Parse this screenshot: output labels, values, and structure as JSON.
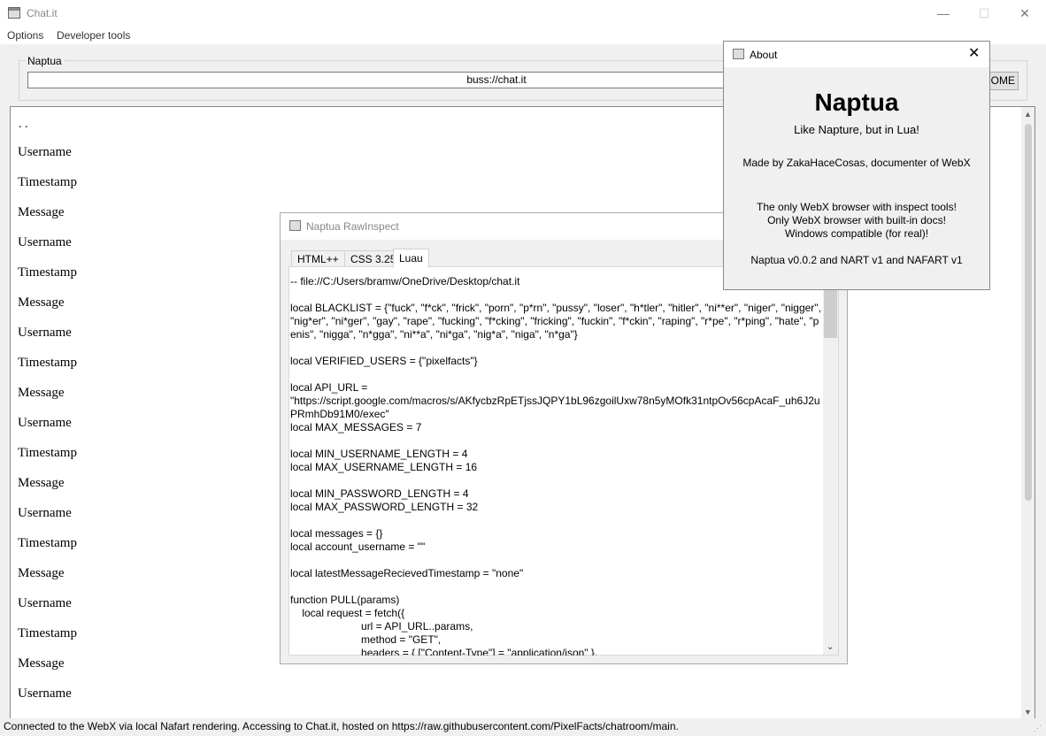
{
  "window": {
    "title": "Chat.it",
    "minimize": "—",
    "maximize": "☐",
    "close": "✕"
  },
  "menu": [
    "Options",
    "Developer tools"
  ],
  "browser": {
    "group_label": "Naptua",
    "url": "buss://chat.it",
    "home_label": "HOME"
  },
  "content": {
    "dots": ". .",
    "lines": [
      "Username",
      "Timestamp",
      "Message",
      "Username",
      "Timestamp",
      "Message",
      "Username",
      "Timestamp",
      "Message",
      "Username",
      "Timestamp",
      "Message",
      "Username",
      "Timestamp",
      "Message",
      "Username",
      "Timestamp",
      "Message",
      "Username"
    ]
  },
  "status": "Connected to the WebX via local Nafart rendering. Accessing to Chat.it, hosted on https://raw.githubusercontent.com/PixelFacts/chatroom/main.",
  "inspect": {
    "title": "Naptua RawInspect",
    "tabs": [
      "HTML++",
      "CSS 3.25",
      "Luau"
    ],
    "active_tab": "Luau",
    "code": "-- file://C:/Users/bramw/OneDrive/Desktop/chat.it\n\nlocal BLACKLIST = {\"fuck\", \"f*ck\", \"frick\", \"porn\", \"p*rn\", \"pussy\", \"loser\", \"h*tler\", \"hitler\", \"ni**er\", \"niger\", \"nigger\", \"nig*er\", \"ni*ger\", \"gay\", \"rape\", \"fucking\", \"f*cking\", \"fricking\", \"fuckin\", \"f*ckin\", \"raping\", \"r*pe\", \"r*ping\", \"hate\", \"penis\", \"nigga\", \"n*gga\", \"ni**a\", \"ni*ga\", \"nig*a\", \"niga\", \"n*ga\"}\n\nlocal VERIFIED_USERS = {\"pixelfacts\"}\n\nlocal API_URL =\n\"https://script.google.com/macros/s/AKfycbzRpETjssJQPY1bL96zgoilUxw78n5yMOfk31ntpOv56cpAcaF_uh6J2uPRmhDb91M0/exec\"\nlocal MAX_MESSAGES = 7\n\nlocal MIN_USERNAME_LENGTH = 4\nlocal MAX_USERNAME_LENGTH = 16\n\nlocal MIN_PASSWORD_LENGTH = 4\nlocal MAX_PASSWORD_LENGTH = 32\n\nlocal messages = {}\nlocal account_username = \"\"\n\nlocal latestMessageRecievedTimestamp = \"none\"\n\nfunction PULL(params)\n    local request = fetch({\n                        url = API_URL..params,\n                        method = \"GET\",\n                        headers = { [\"Content-Type\"] = \"application/json\" },"
  },
  "about": {
    "title": "About",
    "close": "✕",
    "heading": "Naptua",
    "tagline": "Like Napture, but in Lua!",
    "credit": "Made by ZakaHaceCosas, documenter of WebX",
    "features": [
      "The only WebX browser with inspect tools!",
      "Only WebX browser with built-in docs!",
      "Windows compatible (for real)!"
    ],
    "version": "Naptua v0.0.2 and NART v1 and NAFART v1"
  }
}
